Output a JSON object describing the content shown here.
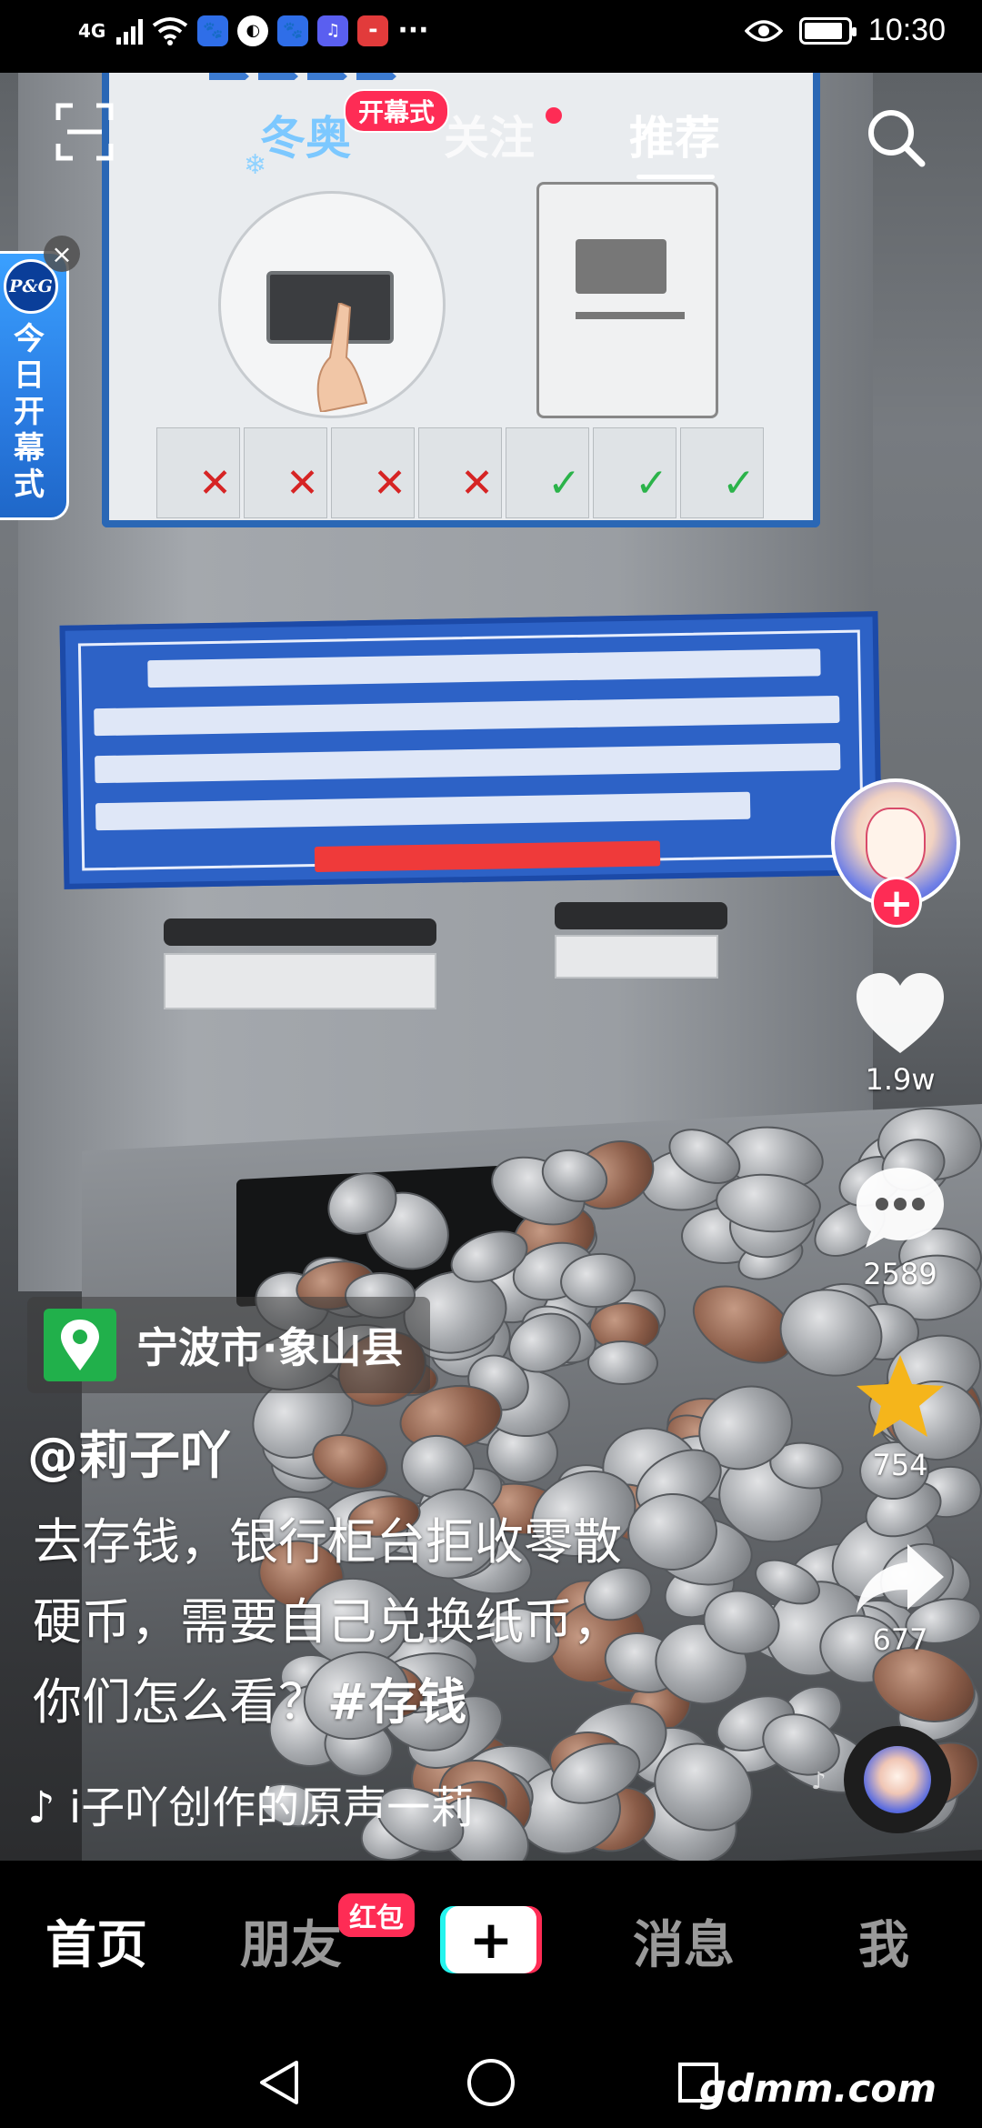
{
  "status_bar": {
    "network": "4G",
    "time": "10:30",
    "battery_level": 0.9,
    "notification_icons": [
      "baidu-icon",
      "compass-icon",
      "baidu-icon",
      "music-icon",
      "huawei-icon"
    ],
    "more": "···"
  },
  "top_tabs": {
    "winter": "冬奥",
    "winter_badge": "开幕式",
    "following": "关注",
    "recommend": "推荐",
    "active": "推荐"
  },
  "ad": {
    "brand": "P&G",
    "text": "今日开幕式",
    "close": "×"
  },
  "actions": {
    "likes": "1.9w",
    "comments": "2589",
    "favorites": "754",
    "shares": "677",
    "follow_symbol": "+"
  },
  "video_info": {
    "location": "宁波市·象山县",
    "author": "@莉子吖",
    "description_lines": [
      "去存钱，银行柜台拒收零散",
      "硬币，需要自己兑换纸币，",
      "你们怎么看？"
    ],
    "hashtag": "#存钱",
    "music_note": "♪",
    "music": "i子吖创作的原声一莉"
  },
  "bottom_nav": {
    "home": "首页",
    "friends": "朋友",
    "friends_badge": "红包",
    "create": "+",
    "messages": "消息",
    "me": "我",
    "active": "首页"
  },
  "watermark": "gdmm.com",
  "colors": {
    "accent_red": "#fe2c55",
    "accent_cyan": "#25f4ee",
    "location_green": "#21b04b",
    "favorite_yellow": "#f5b51b"
  }
}
